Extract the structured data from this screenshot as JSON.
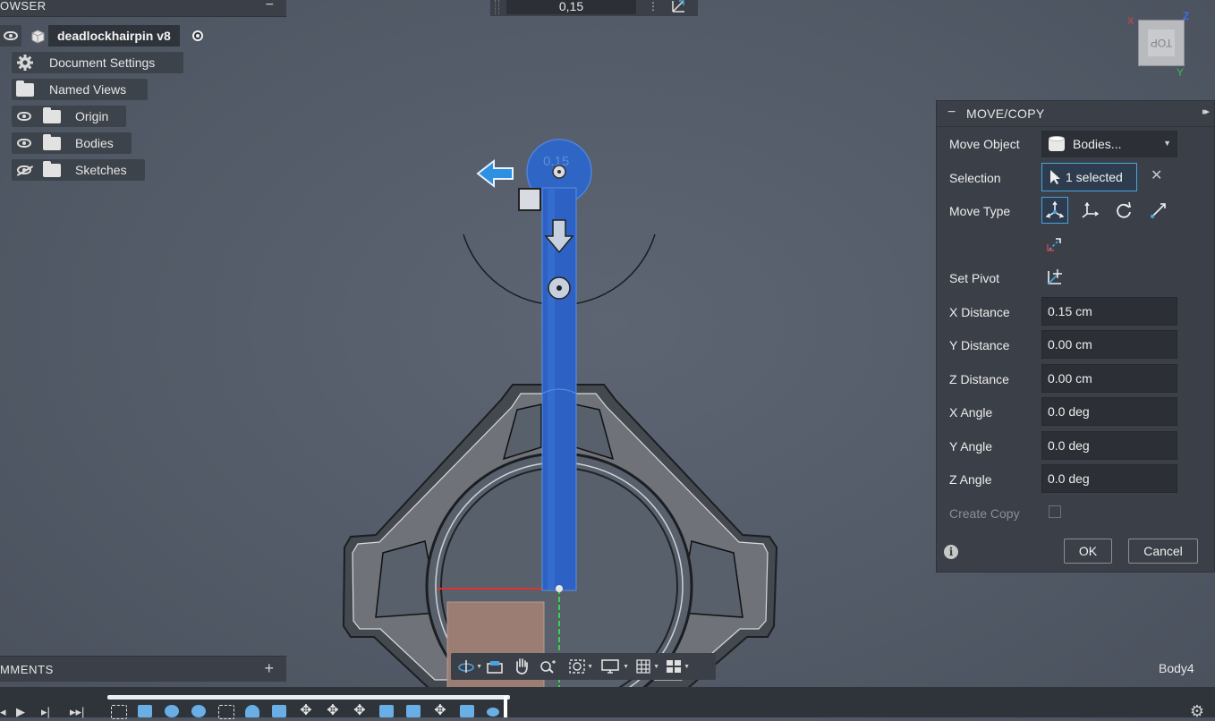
{
  "browser": {
    "title": "OWSER",
    "collapse_icon": "minus-icon",
    "root": {
      "name": "deadlockhairpin v8"
    },
    "items": [
      {
        "label": "Document Settings",
        "icon": "gear-icon"
      },
      {
        "label": "Named Views",
        "icon": "folder-icon"
      },
      {
        "label": "Origin",
        "icon": "folder-icon",
        "visible": true
      },
      {
        "label": "Bodies",
        "icon": "folder-icon",
        "visible": true
      },
      {
        "label": "Sketches",
        "icon": "folder-icon",
        "visible": false
      }
    ]
  },
  "top_input": {
    "value": "0,15"
  },
  "viewport": {
    "manipulator_value": "0.15"
  },
  "viewcube": {
    "face": "TOP",
    "x": "X",
    "y": "Y",
    "z": "Z"
  },
  "panel": {
    "title": "MOVE/COPY",
    "move_object": {
      "label": "Move Object",
      "value": "Bodies..."
    },
    "selection": {
      "label": "Selection",
      "value": "1 selected",
      "clear": "✕"
    },
    "move_type": {
      "label": "Move Type"
    },
    "set_pivot": {
      "label": "Set Pivot"
    },
    "fields": [
      {
        "label": "X Distance",
        "value": "0.15 cm"
      },
      {
        "label": "Y Distance",
        "value": "0.00 cm"
      },
      {
        "label": "Z Distance",
        "value": "0.00 cm"
      },
      {
        "label": "X Angle",
        "value": "0.0 deg"
      },
      {
        "label": "Y Angle",
        "value": "0.0 deg"
      },
      {
        "label": "Z Angle",
        "value": "0.0 deg"
      }
    ],
    "create_copy": {
      "label": "Create Copy",
      "checked": false
    },
    "ok": "OK",
    "cancel": "Cancel",
    "info": "i"
  },
  "comments": {
    "title": "MMENTS",
    "add": "+"
  },
  "status": {
    "body": "Body4"
  },
  "colors": {
    "accent": "#4aa3df",
    "selection_body": "#2f66c8",
    "panel_bg": "#3b4048",
    "canvas_bg": "#535b68"
  }
}
